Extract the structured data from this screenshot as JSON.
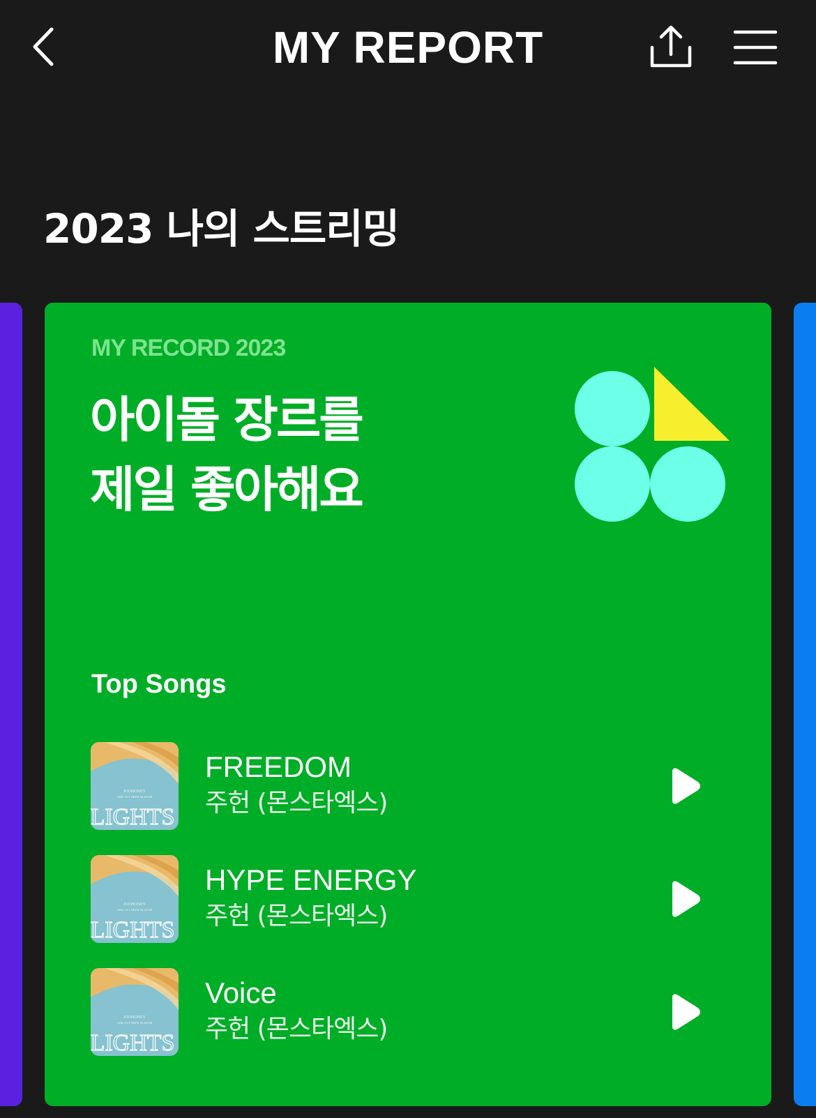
{
  "header": {
    "title": "MY REPORT",
    "back_icon": "chevron-left-icon",
    "share_icon": "share-icon",
    "menu_icon": "hamburger-menu-icon"
  },
  "section": {
    "heading": "2023 나의 스트리밍"
  },
  "card": {
    "record_label": "MY RECORD 2023",
    "headline_line1": "아이돌 장르를",
    "headline_line2": "제일 좋아해요",
    "graphic_icon": "genre-shapes-icon",
    "top_songs_title": "Top Songs",
    "songs": [
      {
        "title": "FREEDOM",
        "artist": "주헌 (몬스타엑스)",
        "album_art_text": "LIGHTS"
      },
      {
        "title": "HYPE ENERGY",
        "artist": "주헌 (몬스타엑스)",
        "album_art_text": "LIGHTS"
      },
      {
        "title": "Voice",
        "artist": "주헌 (몬스타엑스)",
        "album_art_text": "LIGHTS"
      }
    ]
  },
  "colors": {
    "background": "#1a1a1a",
    "card_green": "#00ad26",
    "record_label": "#7ee38f",
    "left_card_purple": "#5a22e0",
    "right_card_blue": "#0a7df0",
    "circle_mint": "#6effe8",
    "triangle_yellow": "#f7ee2e",
    "album_blue": "#86c2cf",
    "album_gold": "#e9b96a"
  }
}
